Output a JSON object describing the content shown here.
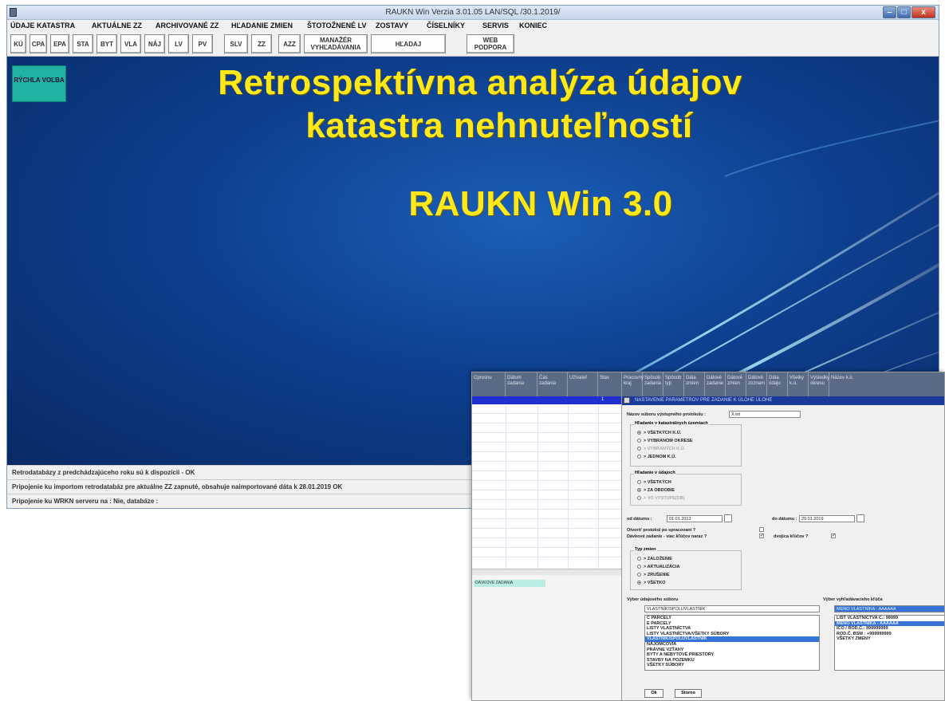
{
  "window": {
    "title": "RAUKN Win Verzia 3.01.05 LAN/SQL /30.1.2019/",
    "minimize": "‒",
    "maximize": "□",
    "close": "x"
  },
  "menu": [
    {
      "label": "ÚDAJE KATASTRA"
    },
    {
      "label": "AKTUÁLNE ZZ"
    },
    {
      "label": "ARCHIVOVANÉ ZZ"
    },
    {
      "label": "HĽADANIE ZMIEN"
    },
    {
      "label": "ŠTOTOŽNENÉ LV"
    },
    {
      "label": "ZOSTAVY"
    },
    {
      "label": "ČÍSELNÍKY"
    },
    {
      "label": "SERVIS"
    },
    {
      "label": "KONIEC"
    }
  ],
  "toolbar": [
    {
      "label": "KÚ"
    },
    {
      "label": "CPA"
    },
    {
      "label": "EPA"
    },
    {
      "label": "STA"
    },
    {
      "label": "BYT"
    },
    {
      "label": "VLA"
    },
    {
      "label": "NÁJ"
    },
    {
      "label": "LV"
    },
    {
      "label": "PV"
    },
    {
      "label": "SLV"
    },
    {
      "label": "ZZ"
    },
    {
      "label": "AZZ"
    },
    {
      "label": "MANAŽÉR VYHĽADÁVANIA"
    },
    {
      "label": "HĽADAJ"
    },
    {
      "label": "WEB PODPORA"
    }
  ],
  "quick_button": "RÝCHLA VOĽBA",
  "hero": {
    "line1": "Retrospektívna analýza údajov",
    "line2": "katastra nehnuteľností",
    "line3": "RAUKN Win 3.0"
  },
  "status": [
    "Retrodatabázy z predchádzajúceho roku sú k dispozícii - OK",
    "Pripojenie ku importom retrodatabáz pre aktuálne ZZ zapnuté, obsahuje naimportované dáta k 28.01.2019 OK",
    "Pripojenie ku WRKN serveru na  : Nie, databáze :"
  ],
  "secondary": {
    "grid_headers": [
      "Cpresnu",
      "Dátum zadania",
      "Čas zadania",
      "Užívateľ",
      "Stav",
      "Pracovný kraj",
      "Spôsob zadania",
      "Spôsob typ",
      "Dáta zmien",
      "Dátové zadanie",
      "Dátové zmien",
      "Dátové zoznam",
      "Dáta údaju",
      "Všetky k.ú.",
      "Výsledky okresu",
      "Název k.ú."
    ],
    "grid_cell": "1",
    "batch_label": "DÁVKOVÉ ZADANIA",
    "dialog_title": "NASTAVENIE PARAMETROV PRE ZADANIE K ÚLOHE ÚLOHE",
    "file_name_label": "Názov súboru výstupného protokolu :",
    "file_name_value": "X.txt",
    "search_cadastre_group": "Hľadanie v katastrálnych územiach",
    "search_cadastre_options": [
      {
        "label": "> VŠETKÝCH K.Ú.",
        "checked": true,
        "disabled": false
      },
      {
        "label": "> VYBRANOM OKRESE",
        "checked": false,
        "disabled": false
      },
      {
        "label": "> VYBRANÝCH K.Ú.",
        "checked": false,
        "disabled": true
      },
      {
        "label": "> JEDNOM K.Ú.",
        "checked": false,
        "disabled": false
      }
    ],
    "search_data_group": "Hľadanie v údajoch",
    "search_data_options": [
      {
        "label": "> VŠETKÝCH",
        "checked": false,
        "disabled": false
      },
      {
        "label": "> ZA OBDOBIE",
        "checked": true,
        "disabled": false
      },
      {
        "label": "> VO VYSTUPE(DB)",
        "checked": false,
        "disabled": true
      }
    ],
    "date_from_label": "od dátumu :",
    "date_from_value": "01.01.2013",
    "date_to_label": "do dátumu :",
    "date_to_value": "29.01.2019",
    "open_protocol_label": "Otvoriť protokol po spracovaní ?",
    "batch_question": "Dávkové zadanie - viac kľúčov naraz ?",
    "dual_key_label": "dvojica kľúčov ?",
    "change_type_group": "Typ zmien",
    "change_type_options": [
      {
        "label": "> ZALOŽENIE",
        "checked": false
      },
      {
        "label": "> AKTUALIZÁCIA",
        "checked": false
      },
      {
        "label": "> ZRUŠENIE",
        "checked": false
      },
      {
        "label": "> VŠETKO",
        "checked": true
      }
    ],
    "data_file_label": "Výber údajového súboru",
    "data_file_value": "VLASTNÍK/SPOLUVLASTNÍK",
    "data_file_options": [
      {
        "label": "C PARCELY",
        "selected": false
      },
      {
        "label": "E PARCELY",
        "selected": false
      },
      {
        "label": "LISTY VLASTNÍCTVA",
        "selected": false
      },
      {
        "label": "LISTY VLASTNÍCTVA/VŠETKY SÚBORY",
        "selected": false
      },
      {
        "label": "VLASTNÍK/SPOLUVLASTNÍK",
        "selected": true
      },
      {
        "label": "NÁJOMCOVIA",
        "selected": false
      },
      {
        "label": "PRÁVNE VZŤAHY",
        "selected": false
      },
      {
        "label": "BYTY A NEBYTOVÉ PRIESTORY",
        "selected": false
      },
      {
        "label": "STAVBY NA POZEMKU",
        "selected": false
      },
      {
        "label": "VŠETKY SÚBORY",
        "selected": false
      }
    ],
    "search_key_label": "Výber vyhľadávacieho kľúča",
    "search_key_value": "MENO VLASTNÍKA - AAAAAA",
    "search_key_options": [
      {
        "label": "LIST VLASTNÍCTVA Č.: 99999",
        "selected": false
      },
      {
        "label": "MENO VLASTNÍKA - AAAAAA",
        "selected": true
      },
      {
        "label": "IČO / ROD.Č.: 999999999",
        "selected": false
      },
      {
        "label": "ROD.Č. BSM : +999999999",
        "selected": false
      },
      {
        "label": "VŠETKY ZMENY",
        "selected": false
      }
    ],
    "ok_button": "Ok",
    "cancel_button": "Storno"
  }
}
